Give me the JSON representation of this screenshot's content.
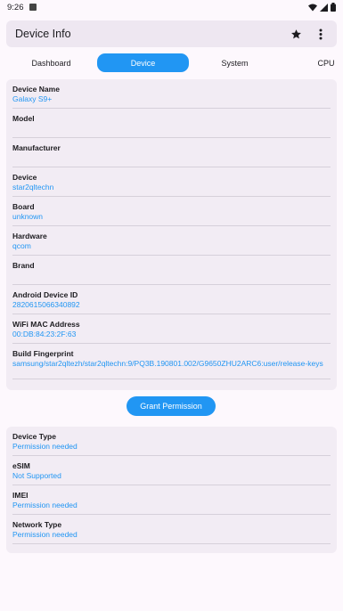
{
  "status_bar": {
    "time": "9:26"
  },
  "app_bar": {
    "title": "Device Info"
  },
  "tabs": [
    {
      "label": "Dashboard"
    },
    {
      "label": "Device"
    },
    {
      "label": "System"
    },
    {
      "label": "CPU"
    }
  ],
  "device_rows": [
    {
      "label": "Device Name",
      "value": "Galaxy S9+"
    },
    {
      "label": "Model",
      "value": ""
    },
    {
      "label": "Manufacturer",
      "value": ""
    },
    {
      "label": "Device",
      "value": "star2qltechn"
    },
    {
      "label": "Board",
      "value": "unknown"
    },
    {
      "label": "Hardware",
      "value": "qcom"
    },
    {
      "label": "Brand",
      "value": ""
    },
    {
      "label": "Android Device ID",
      "value": "2820615066340892"
    },
    {
      "label": "WiFi MAC Address",
      "value": "00:DB:84:23:2F:63"
    },
    {
      "label": "Build Fingerprint",
      "value": "samsung/star2qltezh/star2qltechn:9/PQ3B.190801.002/G9650ZHU2ARC6:user/release-keys"
    }
  ],
  "grant_button": {
    "label": "Grant Permission"
  },
  "permission_rows": [
    {
      "label": "Device Type",
      "value": "Permission needed"
    },
    {
      "label": "eSIM",
      "value": "Not Supported"
    },
    {
      "label": "IMEI",
      "value": "Permission needed"
    },
    {
      "label": "Network Type",
      "value": "Permission needed"
    }
  ],
  "colors": {
    "accent": "#2196f3",
    "surface": "#f2ecf4",
    "background": "#fdf8fd"
  }
}
